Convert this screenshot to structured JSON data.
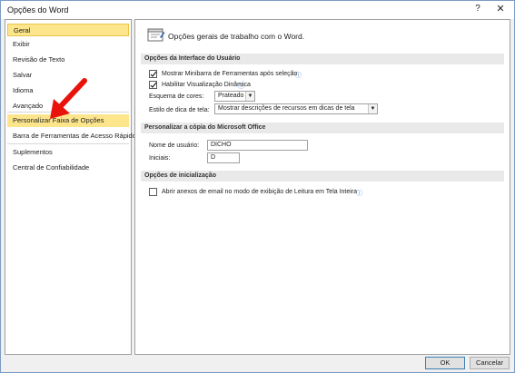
{
  "window": {
    "title": "Opções do Word",
    "help": "?",
    "close": "✕"
  },
  "sidebar": {
    "items": [
      {
        "label": "Geral"
      },
      {
        "label": "Exibir"
      },
      {
        "label": "Revisão de Texto"
      },
      {
        "label": "Salvar"
      },
      {
        "label": "Idioma"
      },
      {
        "label": "Avançado"
      },
      {
        "label": "Personalizar Faixa de Opções"
      },
      {
        "label": "Barra de Ferramentas de Acesso Rápido"
      },
      {
        "label": "Suplementos"
      },
      {
        "label": "Central de Confiabilidade"
      }
    ]
  },
  "main": {
    "header_text": "Opções gerais de trabalho com o Word.",
    "ui_section": {
      "title": "Opções da Interface do Usuário",
      "mini_toolbar": "Mostrar Minibarra de Ferramentas após seleção",
      "live_preview": "Habilitar Visualização Dinâmica",
      "color_scheme_label": "Esquema de cores:",
      "color_scheme_value": "Prateado",
      "tooltip_style_label": "Estilo de dica de tela:",
      "tooltip_style_value": "Mostrar descrições de recursos em dicas de tela"
    },
    "personalize_section": {
      "title": "Personalizar a cópia do Microsoft Office",
      "username_label": "Nome de usuário:",
      "username_value": "DICHO",
      "initials_label": "Iniciais:",
      "initials_value": "D"
    },
    "startup_section": {
      "title": "Opções de inicialização",
      "reading_mode": "Abrir anexos de email no modo de exibição de Leitura em Tela Inteira"
    },
    "info_icon": "ⓘ",
    "dropdown_glyph": "▼"
  },
  "footer": {
    "ok": "OK",
    "cancel": "Cancelar"
  },
  "colors": {
    "selected_bg": "#fde58c",
    "annotation_arrow": "#e8140c"
  }
}
